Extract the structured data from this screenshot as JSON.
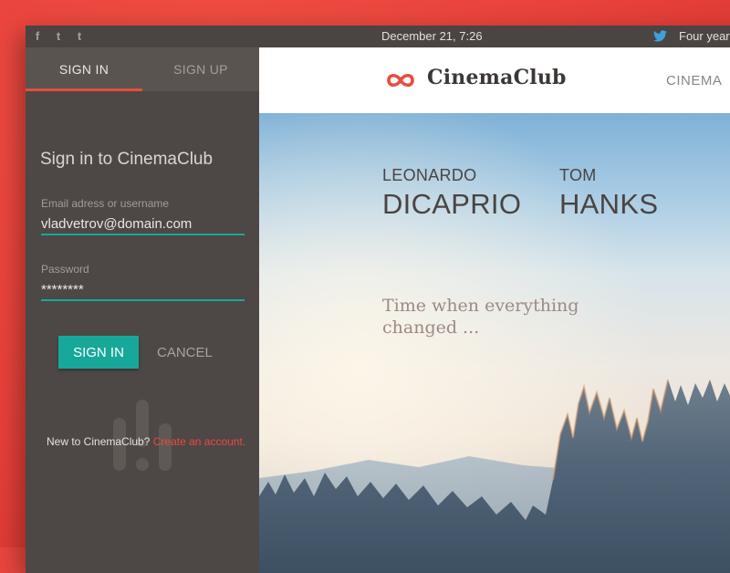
{
  "topbar": {
    "social": [
      "f",
      "t",
      "t"
    ],
    "date": "December 21, 7:26",
    "news": "Four year"
  },
  "sidebar": {
    "tabs": [
      {
        "label": "SIGN IN",
        "active": true
      },
      {
        "label": "SIGN UP",
        "active": false
      }
    ],
    "title": "Sign in to CinemaClub",
    "email": {
      "label": "Email adress or username",
      "value": "vladvetrov@domain.com"
    },
    "password": {
      "label": "Password",
      "value": "********"
    },
    "signin_button": "SIGN IN",
    "cancel_button": "CANCEL",
    "new_user_text": "New to CinemaClub?",
    "create_link": "Create an account."
  },
  "header": {
    "brand": "CinemaClub",
    "nav_item": "CINEMA"
  },
  "hero": {
    "actors": [
      {
        "first": "LEONARDO",
        "last": "DICAPRIO"
      },
      {
        "first": "TOM",
        "last": "HANKS"
      }
    ],
    "tagline": "Time when everything changed ..."
  },
  "colors": {
    "accent": "#17a89a",
    "brand_red": "#e84c3d",
    "panel": "#4d4746",
    "twitter": "#3ea1dc"
  },
  "icons": [
    "facebook-icon",
    "twitter-icon",
    "tumblr-icon",
    "cinemaclub-logo-icon",
    "twitter-bird-icon"
  ]
}
